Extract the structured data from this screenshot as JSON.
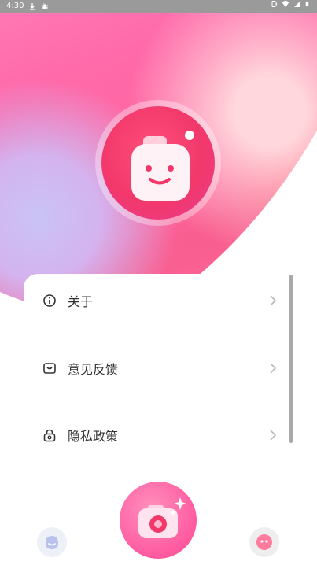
{
  "status_bar": {
    "time": "4:30",
    "left_icons": [
      "download-icon",
      "bug-icon"
    ],
    "right_icons": [
      "vibrate-icon",
      "wifi-icon",
      "signal-icon",
      "battery-icon"
    ]
  },
  "menu": {
    "items": [
      {
        "label": "关于",
        "icon": "info-icon"
      },
      {
        "label": "意见反馈",
        "icon": "feedback-icon"
      },
      {
        "label": "隐私政策",
        "icon": "privacy-lock-icon"
      }
    ]
  },
  "bottom_nav": {
    "left": "home-face-icon",
    "center": "camera-icon",
    "right": "profile-face-icon"
  },
  "colors": {
    "hero_primary": "#ff5aa0",
    "logo_red": "#f2386b",
    "text": "#333333",
    "chevron": "#b8b8b8"
  }
}
